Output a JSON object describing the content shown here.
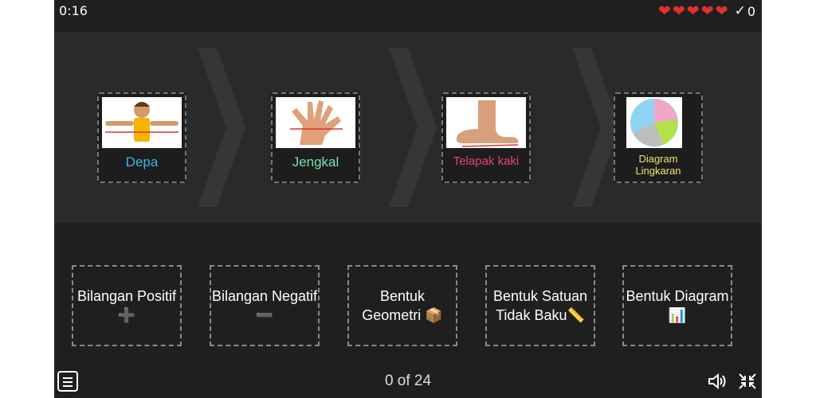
{
  "timer": "0:16",
  "lives": {
    "count": 5,
    "color": "#e0322b"
  },
  "score": "0",
  "icons": {
    "heart": "heart-icon",
    "check": "check-icon",
    "menu": "menu-icon",
    "volume": "volume-icon",
    "collapse": "collapse-icon"
  },
  "cards": [
    {
      "label": "Depa",
      "color": "#3db7e8",
      "image": "arms-spread"
    },
    {
      "label": "Jengkal",
      "color": "#7de0b0",
      "image": "hand-span"
    },
    {
      "label": "Telapak kaki",
      "color": "#e0457b",
      "image": "foot"
    },
    {
      "label": "Diagram Lingkaran",
      "color": "#f0e36a",
      "image": "pie-chart"
    }
  ],
  "answers": [
    {
      "label": "Bilangan Positif ➕"
    },
    {
      "label": "Bilangan Negatif ➖"
    },
    {
      "label": "Bentuk Geometri 📦"
    },
    {
      "label": "Bentuk Satuan Tidak Baku📏"
    },
    {
      "label": "Bentuk Diagram 📊"
    }
  ],
  "progress": "0 of 24"
}
